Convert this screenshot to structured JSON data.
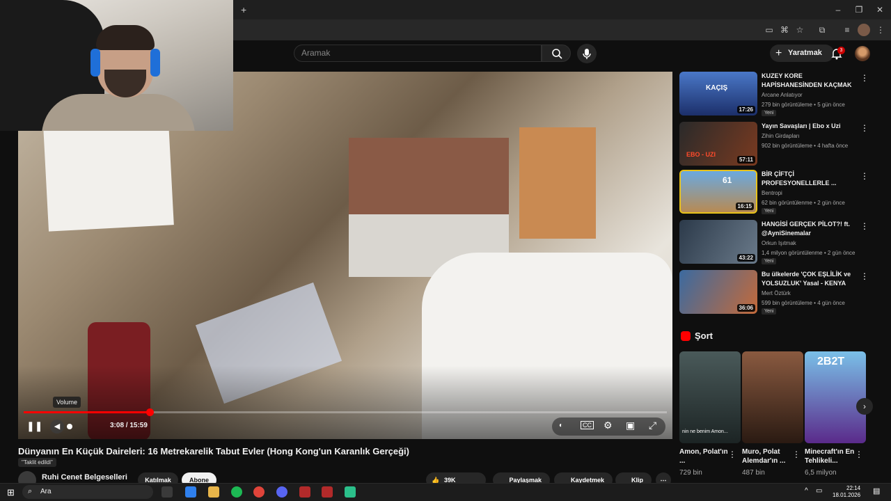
{
  "browser": {
    "new_tab_label": "+"
  },
  "header": {
    "search_placeholder": "Aramak",
    "create_label": "Yaratmak",
    "notif_count": "3"
  },
  "player": {
    "volume_tooltip": "Volume",
    "time": "3:08 / 15:59",
    "progress": 0.196
  },
  "video": {
    "title": "Dünyanın En Küçük Daireleri: 16 Metrekarelik Tabut Evler (Hong Kong'un Karanlık Gerçeği)",
    "badge": "\"Taklit edildi\"",
    "channel": "Ruhi Cenet Belgeselleri",
    "join_label": "Katılmak",
    "subscribe_label": "Abone",
    "likes": "39K",
    "share_label": "Paylaşmak",
    "save_label": "Kaydetmek",
    "clip_label": "Klip"
  },
  "recommendations": [
    {
      "title": "KUZEY KORE HAPİSHANESİNDEN KAÇMAK",
      "channel": "Arcane Anlatıyor",
      "stats": "279 bin görüntüleme • 5 gün önce",
      "new": "Yeni",
      "duration": "17:26",
      "thumb_text": "KAÇIŞ"
    },
    {
      "title": "Yayın Savaşları | Ebo x Uzi",
      "channel": "Zihin Girdapları",
      "stats": "902 bin görüntüleme • 4 hafta önce",
      "new": "",
      "duration": "57:11",
      "thumb_text": "EBO - UZI"
    },
    {
      "title": "BİR ÇİFTÇİ PROFESYONELLERLE ...",
      "channel": "Bentropi",
      "stats": "62 bin görüntülenme • 2 gün önce",
      "new": "Yeni",
      "duration": "16:15",
      "thumb_text": "61"
    },
    {
      "title": "HANGİSİ GERÇEK PİLOT?! ft. @AyniSinemalar",
      "channel": "Orkun Işıtmak",
      "stats": "1,4 milyon görüntülenme • 2 gün önce",
      "new": "Yeni",
      "duration": "43:22",
      "thumb_text": ""
    },
    {
      "title": "Bu ülkelerde 'ÇOK EŞLİLİK ve YOLSUZLUK' Yasal - KENYA",
      "channel": "Mert Öztürk",
      "stats": "599 bin görüntüleme • 4 gün önce",
      "new": "Yeni",
      "duration": "36:06",
      "thumb_text": ""
    }
  ],
  "shorts": {
    "heading": "Şort",
    "items": [
      {
        "title": "Amon, Polat'ın ...",
        "views": "729 bin",
        "thumb_text": "nin ne benim Amon..."
      },
      {
        "title": "Muro, Polat Alemdar'ın ...",
        "views": "487 bin",
        "thumb_text": ""
      },
      {
        "title": "Minecraft'ın En Tehlikeli...",
        "views": "6,5 milyon",
        "thumb_text": "2B2T"
      }
    ]
  },
  "taskbar": {
    "search_label": "Ara",
    "time": "22:14",
    "date": "18.01.2026"
  },
  "colors": {
    "accent": "#ff0000",
    "bg": "#0f0f0f"
  }
}
